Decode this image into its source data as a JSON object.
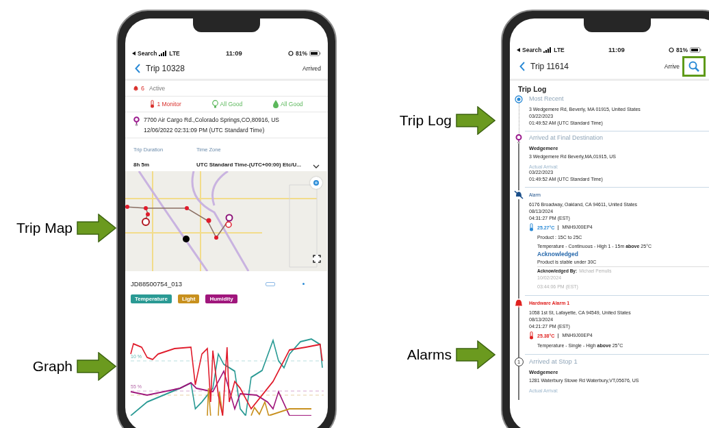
{
  "left_phone": {
    "callouts": [
      {
        "label": "Trip Map"
      },
      {
        "label": "Graph"
      }
    ],
    "status_bar": {
      "carrier": "Search",
      "network": "LTE",
      "time": "11:09",
      "battery": "81%"
    },
    "header": {
      "title": "Trip 10328",
      "status": "Arrived"
    },
    "alerts": {
      "count": "6",
      "label": "Active"
    },
    "sensors": [
      {
        "kind": "temperature",
        "text": "1 Monitor",
        "color": "#d9302c"
      },
      {
        "kind": "light",
        "text": "All Good",
        "color": "#5cb85c"
      },
      {
        "kind": "humidity",
        "text": "All Good",
        "color": "#5cb85c"
      }
    ],
    "location": {
      "address": "7700 Air Cargo Rd.,Colorado Springs,CO,80916, US",
      "time": "12/06/2022 02:31:09 PM (UTC Standard Time)"
    },
    "details": [
      {
        "label": "Trip Duration",
        "value": "8h 5m"
      },
      {
        "label": "Time Zone",
        "value": "UTC Standard Time-(UTC+00:00) Etc/U..."
      }
    ],
    "device": "JD88500754_013",
    "legend": [
      {
        "label": "Temperature",
        "color": "#2a9a94"
      },
      {
        "label": "Light",
        "color": "#c8901e"
      },
      {
        "label": "Humidity",
        "color": "#a0167c"
      }
    ],
    "graph_labels": [
      "10 %",
      "55 %"
    ]
  },
  "right_phone": {
    "callouts": [
      {
        "label": "Trip Log"
      },
      {
        "label": "Alarms"
      }
    ],
    "status_bar": {
      "carrier": "Search",
      "network": "LTE",
      "time": "11:09",
      "battery": "81%"
    },
    "header": {
      "title": "Trip 11614",
      "status": "Arrive",
      "search_highlighted": true
    },
    "section_title": "Trip Log",
    "entries": [
      {
        "kind": "most_recent",
        "title": "Most Recent",
        "lines": [
          "3 Wedgemere Rd, Beverly, MA 01915, United States",
          "03/22/2023",
          "01:49:52 AM (UTC Standard Time)"
        ]
      },
      {
        "kind": "destination",
        "title": "Arrived at Final Destination",
        "name": "Wedgemere",
        "address": "3 Wedgemere Rd Beverly,MA,01915, US",
        "arrival_label": "Actual Arrival:",
        "lines": [
          "03/22/2023",
          "01:49:52 AM (UTC Standard Time)"
        ]
      },
      {
        "kind": "alarm",
        "title": "Alarm",
        "lines": [
          "6176 Broadway, Oakland, CA 94611, United States",
          "08/13/2024",
          "04:31:27 PM (EST)"
        ],
        "reading": "25.27°C",
        "device": "MNH9J00EP4",
        "product": "Product : 15C to 25C",
        "rule": "Temperature - Continuous - High 1 - 15m **above** 25°C",
        "ack_title": "Acknowledged",
        "ack_note": "Product is stable under 30C",
        "ack_label": "Acknowledged By:",
        "ack_name": "Michael Pemulis",
        "ack_lines": [
          "10/02/2024",
          "03:44:06 PM (EST)"
        ]
      },
      {
        "kind": "hardware_alarm",
        "title": "Hardware Alarm 1",
        "lines": [
          "1058 1st St, Lafayette, CA 94549, United States",
          "08/13/2024",
          "04:21:27 PM (EST)"
        ],
        "reading": "25.38°C",
        "device": "MNH9J00EP4",
        "rule": "Temperature - Single - High **above** 25°C"
      },
      {
        "kind": "stop",
        "title": "Arrived at Stop 1",
        "marker": "1",
        "name": "Wedgemere",
        "address": "1281 Waterbury Stowe Rd Waterbury,VT,05676, US",
        "arrival_label": "Actual Arrival:"
      }
    ]
  }
}
